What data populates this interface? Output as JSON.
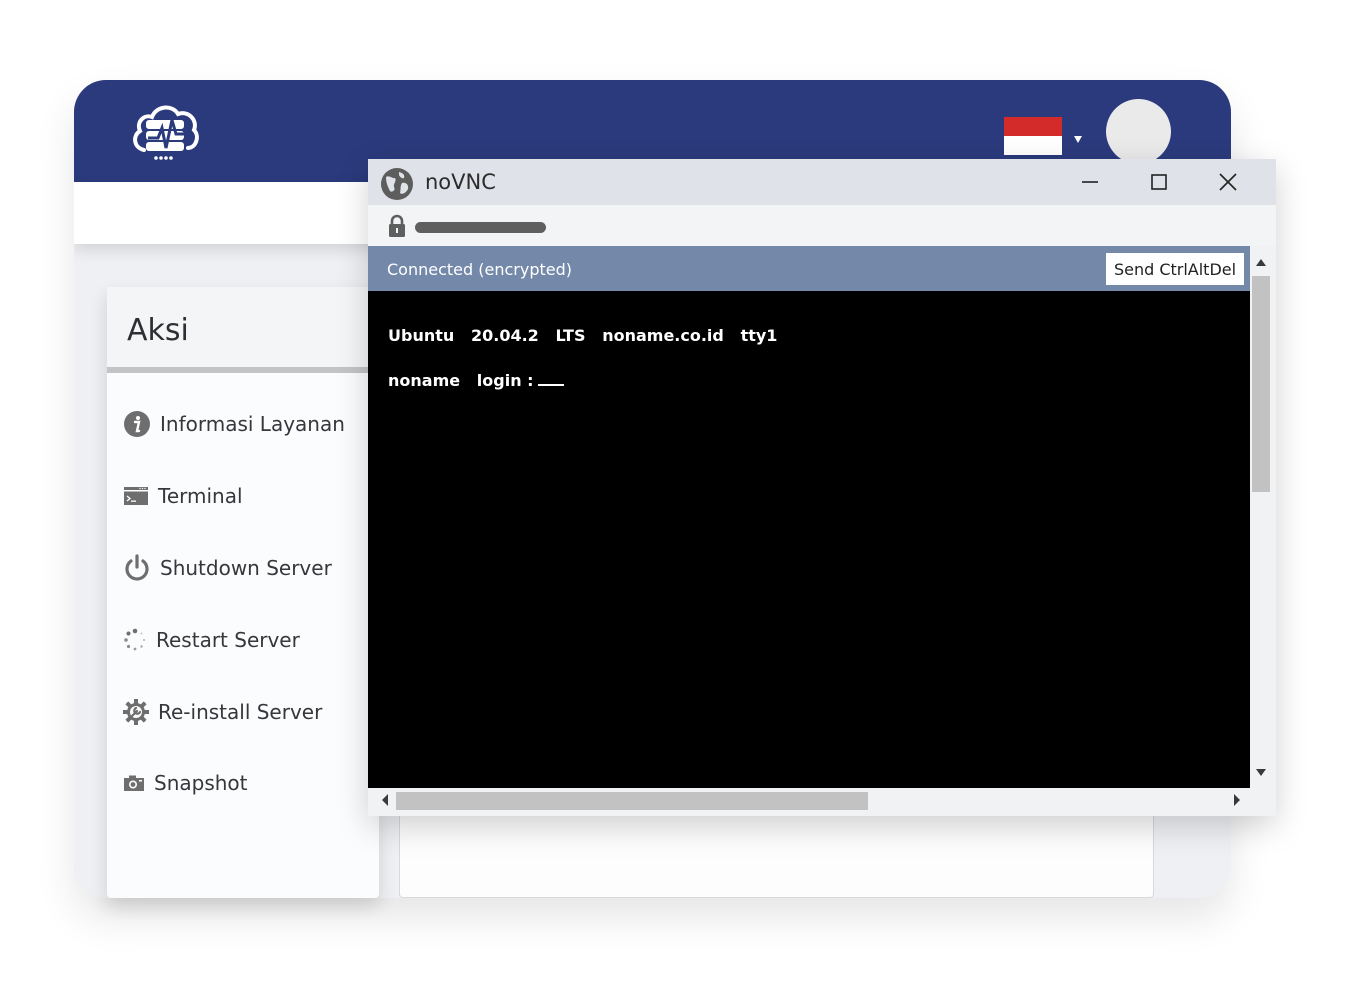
{
  "app": {
    "logo": "cloud-server-logo",
    "language_flag": "indonesia-flag",
    "colors": {
      "header": "#2a3a7c",
      "flag_red": "#d32a2a",
      "flag_white": "#ffffff"
    }
  },
  "aksi": {
    "title": "Aksi",
    "items": [
      {
        "label": "Informasi Layanan",
        "icon": "info-icon"
      },
      {
        "label": "Terminal",
        "icon": "terminal-icon"
      },
      {
        "label": "Shutdown Server",
        "icon": "power-icon"
      },
      {
        "label": "Restart Server",
        "icon": "spinner-icon"
      },
      {
        "label": "Re-install Server",
        "icon": "gear-wrench-icon"
      },
      {
        "label": "Snapshot",
        "icon": "camera-icon"
      }
    ]
  },
  "vnc": {
    "title": "noVNC",
    "icon": "globe-icon",
    "status": "Connected (encrypted)",
    "send_cad_label": "Send CtrlAltDel",
    "status_color": "#7489aa",
    "terminal": {
      "line1": "Ubuntu   20.04.2   LTS   noname.co.id   tty1",
      "line2": "noname   login :"
    }
  }
}
